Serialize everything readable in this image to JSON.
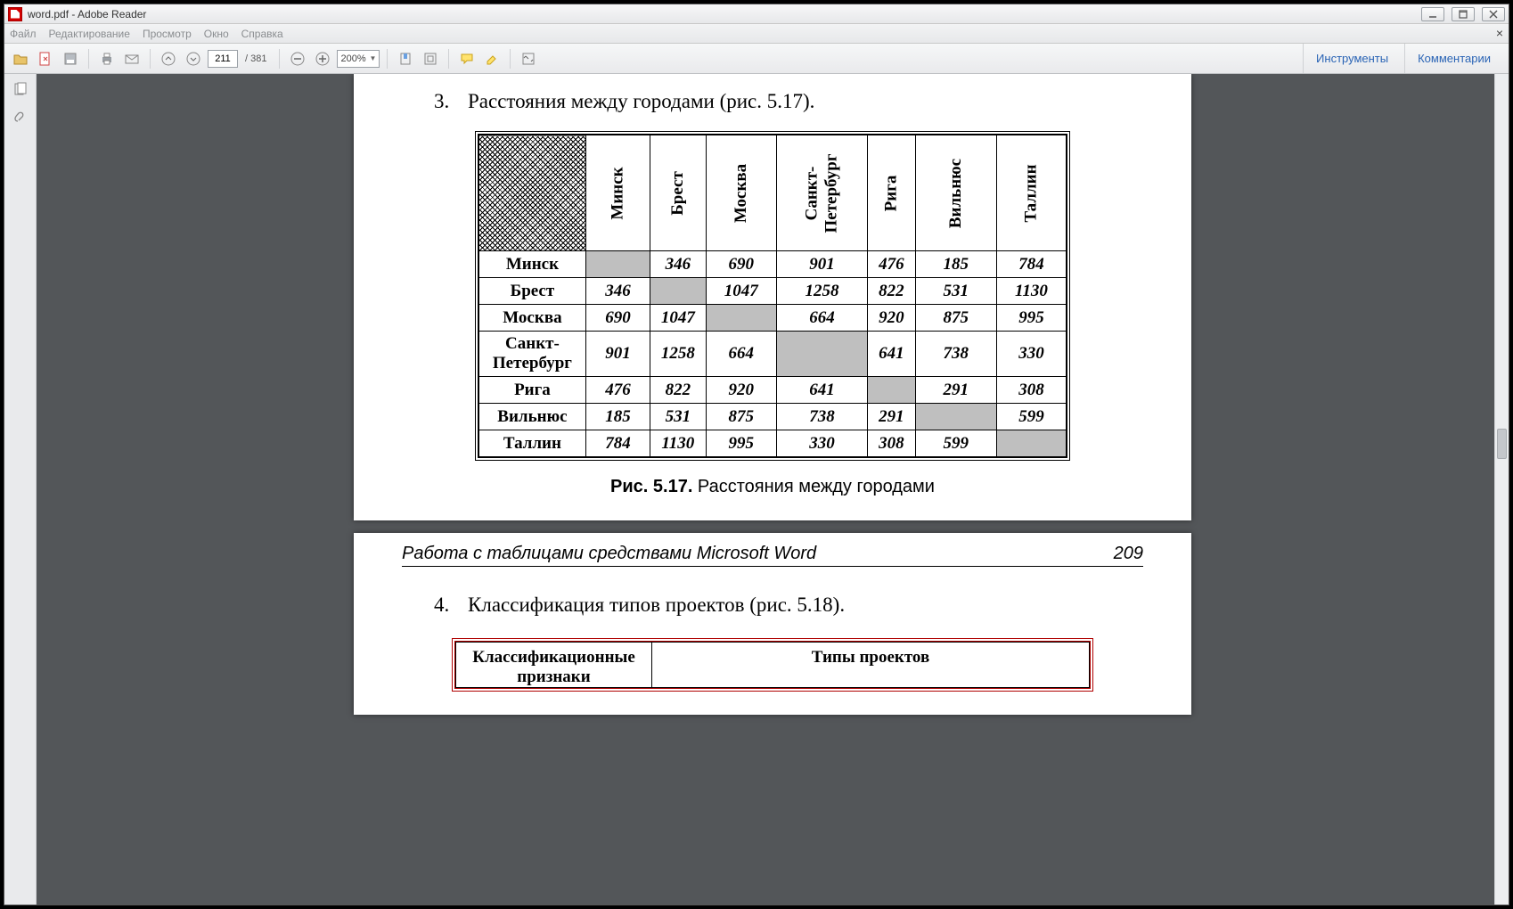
{
  "window": {
    "title": "word.pdf - Adobe Reader"
  },
  "menu": {
    "file": "Файл",
    "edit": "Редактирование",
    "view": "Просмотр",
    "window": "Окно",
    "help": "Справка"
  },
  "toolbar": {
    "page_current": "211",
    "page_total": "/  381",
    "zoom": "200%",
    "tab_tools": "Инструменты",
    "tab_comments": "Комментарии"
  },
  "doc": {
    "item3_num": "3.",
    "item3_text": "Расстояния между городами (рис. 5.17).",
    "cities": [
      "Минск",
      "Брест",
      "Москва",
      "Санкт-Петербург",
      "Рига",
      "Вильнюс",
      "Таллин"
    ],
    "col_head_spb": "Санкт-\nПетербург",
    "matrix": [
      [
        null,
        346,
        690,
        901,
        476,
        185,
        784
      ],
      [
        346,
        null,
        1047,
        1258,
        822,
        531,
        1130
      ],
      [
        690,
        1047,
        null,
        664,
        920,
        875,
        995
      ],
      [
        901,
        1258,
        664,
        null,
        641,
        738,
        330
      ],
      [
        476,
        822,
        920,
        641,
        null,
        291,
        308
      ],
      [
        185,
        531,
        875,
        738,
        291,
        null,
        599
      ],
      [
        784,
        1130,
        995,
        330,
        308,
        599,
        null
      ]
    ],
    "fig_caption_bold": "Рис. 5.17.",
    "fig_caption_rest": " Расстояния между городами",
    "footer_title": "Работа с таблицами средствами Microsoft Word",
    "footer_page": "209",
    "item4_num": "4.",
    "item4_text": "Классификация типов проектов (рис. 5.18).",
    "class_h1": "Классификационные\nпризнаки",
    "class_h2": "Типы проектов"
  }
}
